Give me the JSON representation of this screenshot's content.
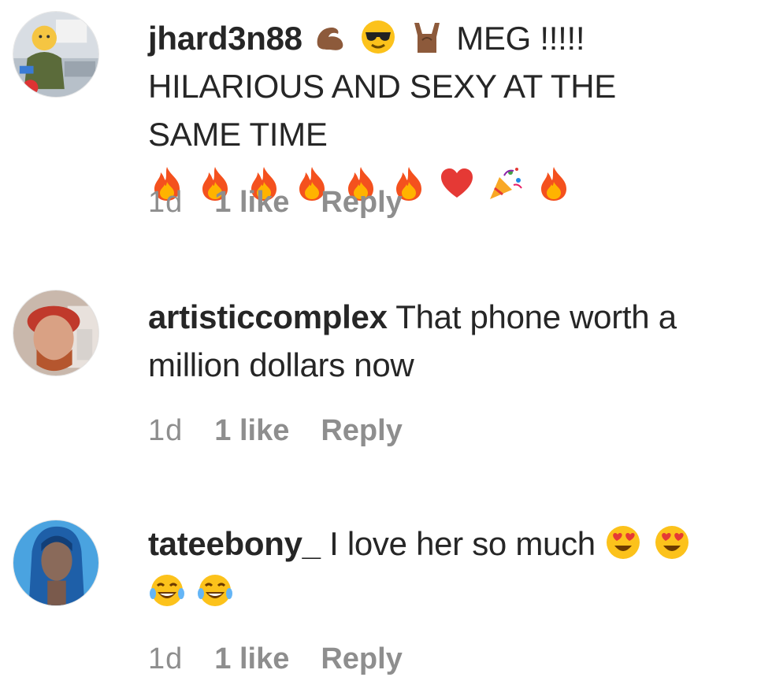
{
  "comments": [
    {
      "username": "jhard3n88",
      "text_before_emoji": "",
      "leading_emojis": [
        "flexed-biceps-emoji",
        "sunglasses-face-emoji",
        "sign-of-horns-emoji"
      ],
      "text_line1": "MEG !!!!!",
      "text_line2": "HILARIOUS AND SEXY AT THE",
      "text_line3": "SAME TIME",
      "trailing_emojis": [
        "fire-emoji",
        "fire-emoji",
        "fire-emoji",
        "fire-emoji",
        "fire-emoji",
        "fire-emoji",
        "red-heart-emoji",
        "party-popper-emoji",
        "fire-emoji"
      ],
      "time": "1d",
      "likes": "1 like",
      "reply": "Reply"
    },
    {
      "username": "artisticcomplex",
      "text_line1": "That phone worth a",
      "text_line2": "million dollars now",
      "time": "1d",
      "likes": "1 like",
      "reply": "Reply"
    },
    {
      "username": "tateebony_",
      "text_line1": "I love her so much",
      "trailing_emojis_line1": [
        "heart-eyes-emoji",
        "heart-eyes-emoji"
      ],
      "trailing_emojis_line2": [
        "tears-of-joy-emoji",
        "tears-of-joy-emoji"
      ],
      "time": "1d",
      "likes": "1 like",
      "reply": "Reply"
    }
  ],
  "colors": {
    "text": "#262626",
    "meta": "#8e8e8e",
    "background": "#ffffff"
  }
}
